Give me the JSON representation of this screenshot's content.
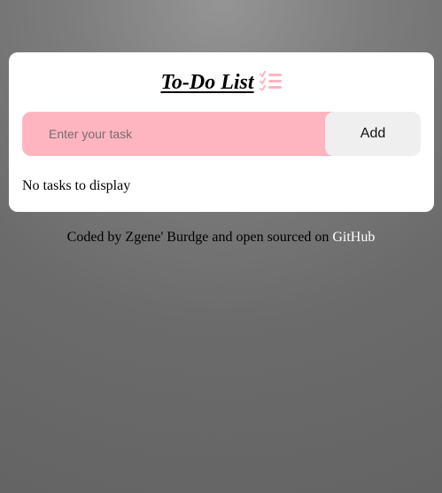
{
  "app": {
    "title": "To-Do List",
    "title_icon": "checklist-icon"
  },
  "form": {
    "input_value": "",
    "input_placeholder": "Enter your task",
    "add_label": "Add"
  },
  "tasks": {
    "items": [],
    "empty_message": "No tasks to display"
  },
  "footer": {
    "prefix": "Coded by Zgene' Burdge and open sourced on",
    "link_label": "GitHub"
  },
  "colors": {
    "input_background": "#ffb5c0",
    "button_background": "#efefef",
    "icon_accent": "#ffb5c0",
    "link": "#ffffff"
  }
}
